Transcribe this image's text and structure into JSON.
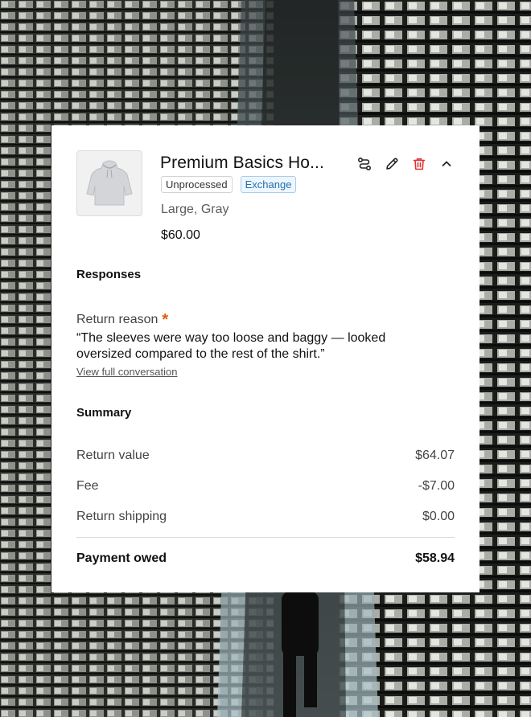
{
  "product": {
    "title": "Premium Basics Ho...",
    "image": "hoodie-icon",
    "status_badge": "Unprocessed",
    "type_badge": "Exchange",
    "variant": "Large, Gray",
    "price": "$60.00"
  },
  "actions": {
    "icons": [
      "route-icon",
      "pencil-icon",
      "trash-icon",
      "chevron-up-icon"
    ],
    "delete_color": "#e03131"
  },
  "responses": {
    "heading": "Responses",
    "reason_label": "Return reason",
    "required_mark": "*",
    "reason_text": "“The sleeves were way too loose and baggy — looked oversized compared to the rest of the shirt.”",
    "conversation_link": "View full conversation"
  },
  "summary": {
    "heading": "Summary",
    "rows": [
      {
        "label": "Return value",
        "value": "$64.07"
      },
      {
        "label": "Fee",
        "value": "-$7.00"
      },
      {
        "label": "Return shipping",
        "value": "$0.00"
      }
    ],
    "total_label": "Payment owed",
    "total_value": "$58.94"
  },
  "colors": {
    "exchange_badge": "#1f6fb3",
    "required_mark": "#e8590c"
  }
}
